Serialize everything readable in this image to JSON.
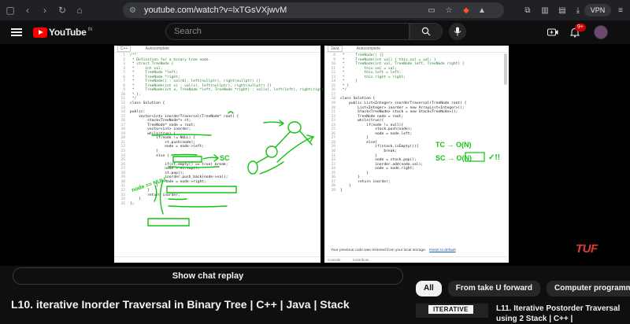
{
  "browser": {
    "url": "youtube.com/watch?v=lxTGsVXjwvM",
    "vpn_label": "VPN",
    "extension_badge": "16"
  },
  "youtube": {
    "logo_text": "YouTube",
    "country_code": "IN",
    "search_placeholder": "Search",
    "notification_count": "9+"
  },
  "player": {
    "left_panel": {
      "language": "C++",
      "autocomplete": "Autocomplete",
      "lines": [
        {
          "n": "1",
          "t": "/**"
        },
        {
          "n": "2",
          "t": " * Definition for a binary tree node."
        },
        {
          "n": "3",
          "t": " * struct TreeNode {"
        },
        {
          "n": "4",
          "t": " *     int val;"
        },
        {
          "n": "5",
          "t": " *     TreeNode *left;"
        },
        {
          "n": "6",
          "t": " *     TreeNode *right;"
        },
        {
          "n": "7",
          "t": " *     TreeNode() : val(0), left(nullptr), right(nullptr) {}"
        },
        {
          "n": "8",
          "t": " *     TreeNode(int x) : val(x), left(nullptr), right(nullptr) {}"
        },
        {
          "n": "9",
          "t": " *     TreeNode(int x, TreeNode *left, TreeNode *right) : val(x), left(left), right(right) {}"
        },
        {
          "n": "10",
          "t": " * };"
        },
        {
          "n": "11",
          "t": " */"
        },
        {
          "n": "12",
          "t": "class Solution {"
        },
        {
          "n": "13",
          "t": ""
        },
        {
          "n": "14",
          "t": "public:"
        },
        {
          "n": "15",
          "t": "    vector<int> inorderTraversal(TreeNode* root) {"
        },
        {
          "n": "16",
          "t": "        stack<TreeNode*> st;"
        },
        {
          "n": "17",
          "t": "        TreeNode* node = root;"
        },
        {
          "n": "18",
          "t": "        vector<int> inorder;"
        },
        {
          "n": "19",
          "t": "        while(true) {"
        },
        {
          "n": "20",
          "t": "            if(node != NULL) {"
        },
        {
          "n": "21",
          "t": "                st.push(node);"
        },
        {
          "n": "22",
          "t": "                node = node->left;"
        },
        {
          "n": "23",
          "t": "            }"
        },
        {
          "n": "24",
          "t": "            else {"
        },
        {
          "n": "25",
          "t": ""
        },
        {
          "n": "26",
          "t": "                if(st.empty() == true) break;"
        },
        {
          "n": "27",
          "t": "                node = st.top();"
        },
        {
          "n": "28",
          "t": "                st.pop();"
        },
        {
          "n": "29",
          "t": "                inorder.push_back(node->val);"
        },
        {
          "n": "30",
          "t": "                node = node->right;"
        },
        {
          "n": "31",
          "t": "            }"
        },
        {
          "n": "32",
          "t": "        }"
        },
        {
          "n": "33",
          "t": "        return inorder;"
        },
        {
          "n": "34",
          "t": "    }"
        },
        {
          "n": "35",
          "t": "};"
        }
      ]
    },
    "right_panel": {
      "language": "Java",
      "autocomplete": "Autocomplete",
      "lines": [
        {
          "n": "8",
          "t": " *     TreeNode() {}"
        },
        {
          "n": "9",
          "t": " *     TreeNode(int val) { this.val = val; }"
        },
        {
          "n": "10",
          "t": " *     TreeNode(int val, TreeNode left, TreeNode right) {"
        },
        {
          "n": "11",
          "t": " *         this.val = val;"
        },
        {
          "n": "12",
          "t": " *         this.left = left;"
        },
        {
          "n": "13",
          "t": " *         this.right = right;"
        },
        {
          "n": "14",
          "t": " *     }"
        },
        {
          "n": "15",
          "t": " * }"
        },
        {
          "n": "16",
          "t": " */"
        },
        {
          "n": "17",
          "t": ""
        },
        {
          "n": "18",
          "t": "class Solution {"
        },
        {
          "n": "19",
          "t": "    public List<Integer> inorderTraversal(TreeNode root) {"
        },
        {
          "n": "20",
          "t": "        List<Integer> inorder = new ArrayList<Integer>();"
        },
        {
          "n": "21",
          "t": "        Stack<TreeNode> stack = new Stack<TreeNode>();"
        },
        {
          "n": "22",
          "t": "        TreeNode node = root;"
        },
        {
          "n": "23",
          "t": "        while(true){"
        },
        {
          "n": "24",
          "t": "            if(node != null){"
        },
        {
          "n": "25",
          "t": "                stack.push(node);"
        },
        {
          "n": "26",
          "t": "                node = node.left;"
        },
        {
          "n": "27",
          "t": "            }"
        },
        {
          "n": "28",
          "t": "            else{"
        },
        {
          "n": "29",
          "t": "                if(stack.isEmpty()){"
        },
        {
          "n": "30",
          "t": "                    break;"
        },
        {
          "n": "31",
          "t": "                }"
        },
        {
          "n": "32",
          "t": "                node = stack.pop();"
        },
        {
          "n": "33",
          "t": "                inorder.add(node.val);"
        },
        {
          "n": "34",
          "t": "                node = node.right;"
        },
        {
          "n": "35",
          "t": "            }"
        },
        {
          "n": "36",
          "t": "        }"
        },
        {
          "n": "37",
          "t": "        return inorder;"
        },
        {
          "n": "38",
          "t": "    }"
        },
        {
          "n": "39",
          "t": "}"
        }
      ],
      "restore_msg": "Your previous code was restored from your local storage.",
      "reset_link": "Reset to default",
      "footer": [
        "Console",
        "Contribute"
      ]
    },
    "annotations": {
      "sc_label": "SC",
      "tc_eq": "TC → O(N)",
      "sc_eq": "SC → O(N)",
      "tick": "✓!!",
      "node_null": "node == NULL",
      "node_text": "node"
    },
    "watermark": "TUF"
  },
  "below": {
    "show_chat_replay": "Show chat replay",
    "video_title": "L10. iterative Inorder Traversal in Binary Tree | C++ | Java | Stack",
    "chips": [
      "All",
      "From take U forward",
      "Computer programm"
    ],
    "next_thumb_label": "ITERATIVE",
    "next_video_title": "L11. Iterative Postorder Traversal using 2 Stack | C++ |"
  }
}
